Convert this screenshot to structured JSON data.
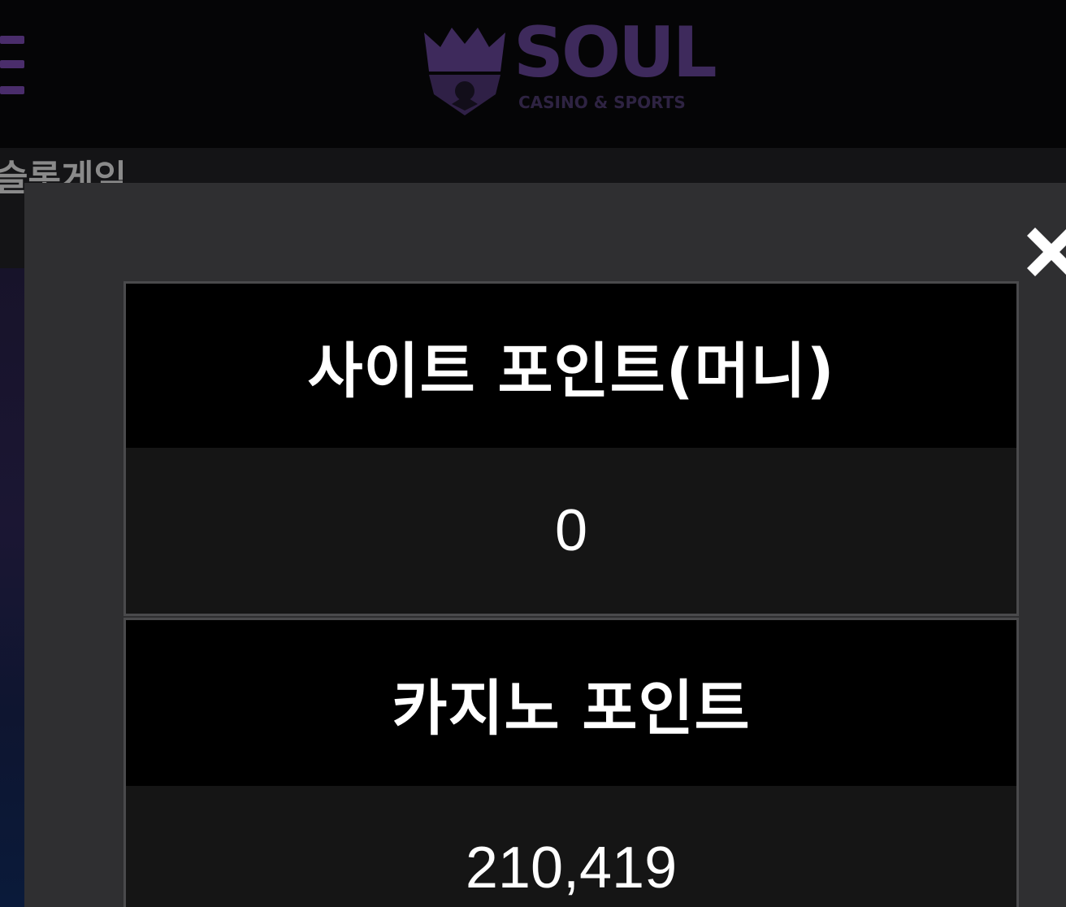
{
  "header": {
    "logo": {
      "word": "SOUL",
      "tagline": "CASINO & SPORTS"
    },
    "menu_icon": "hamburger-menu-icon"
  },
  "background": {
    "partial_title": "슬롯게임"
  },
  "modal": {
    "close_icon": "close-icon",
    "site_points": {
      "label": "사이트 포인트(머니)",
      "value": "0"
    },
    "casino_points": {
      "label": "카지노 포인트",
      "value": "210,419"
    }
  },
  "colors": {
    "brand_purple": "#3e2a5c",
    "modal_bg": "#2f2f31",
    "card_border": "#4a4a4c",
    "value_bg": "#151515"
  }
}
